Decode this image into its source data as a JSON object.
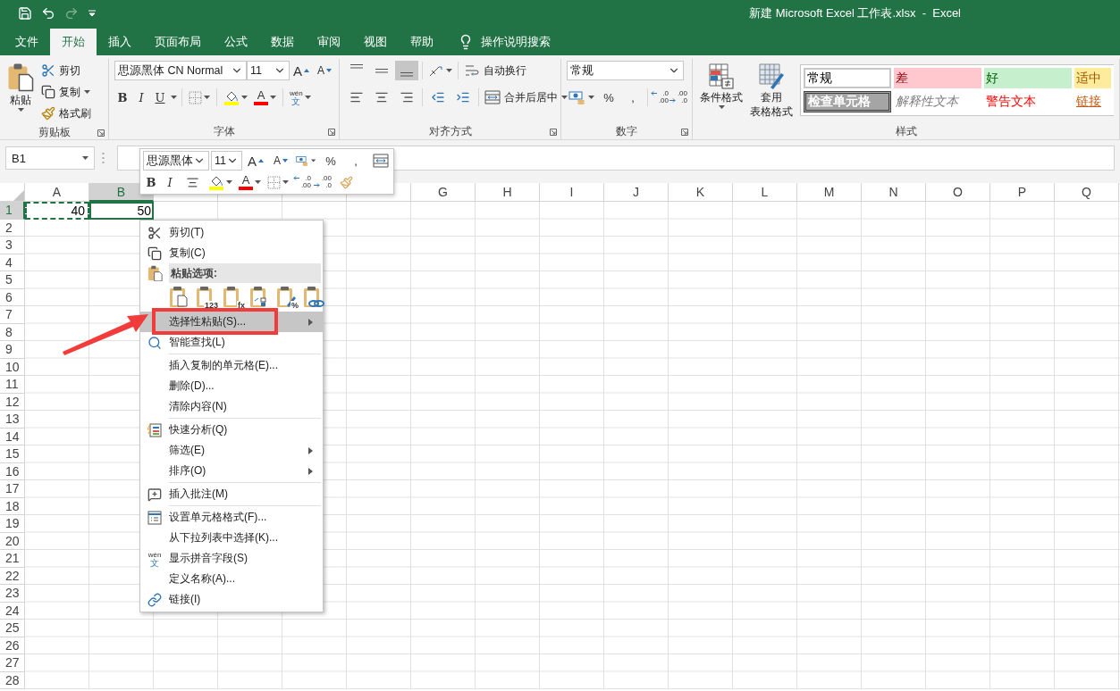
{
  "title_bar": {
    "title": "新建 Microsoft Excel 工作表.xlsx  -  Excel"
  },
  "tabs": [
    {
      "label": "文件",
      "selected": false
    },
    {
      "label": "开始",
      "selected": true
    },
    {
      "label": "插入",
      "selected": false
    },
    {
      "label": "页面布局",
      "selected": false
    },
    {
      "label": "公式",
      "selected": false
    },
    {
      "label": "数据",
      "selected": false
    },
    {
      "label": "审阅",
      "selected": false
    },
    {
      "label": "视图",
      "selected": false
    },
    {
      "label": "帮助",
      "selected": false
    }
  ],
  "tell_me": {
    "label": "操作说明搜索"
  },
  "ribbon": {
    "clipboard": {
      "label": "剪贴板",
      "paste": "粘贴",
      "cut": "剪切",
      "copy": "复制",
      "format_painter": "格式刷"
    },
    "font": {
      "label": "字体",
      "font_name": "思源黑体 CN Normal",
      "font_size": "11",
      "grow": "A",
      "shrink": "A",
      "bold": "B",
      "italic": "I",
      "underline": "U",
      "font_color": "A",
      "phonetic": [
        "wén",
        "文"
      ]
    },
    "alignment": {
      "label": "对齐方式",
      "wrap_text": "自动换行",
      "merge_center": "合并后居中"
    },
    "number": {
      "label": "数字",
      "format": "常规",
      "percent": "%",
      "comma": ",",
      "decimal_buttons": [
        {
          "kind": "increase",
          "top": ".0",
          "bottom": ".00"
        },
        {
          "kind": "decrease",
          "top": ".00",
          "bottom": ".0"
        }
      ]
    },
    "styles": {
      "label": "样式",
      "conditional_format": "条件格式",
      "table_format": [
        "套用",
        "表格格式"
      ],
      "cell_styles": [
        {
          "label": "常规",
          "kind": "normal"
        },
        {
          "label": "差",
          "kind": "bad"
        },
        {
          "label": "好",
          "kind": "good"
        },
        {
          "label": "适中",
          "kind": "neutral"
        },
        {
          "label": "检查单元格",
          "kind": "check"
        },
        {
          "label": "解释性文本",
          "kind": "explanatory"
        },
        {
          "label": "警告文本",
          "kind": "warning"
        },
        {
          "label": "链接",
          "kind": "link"
        }
      ]
    }
  },
  "formula_bar": {
    "name_box": "B1"
  },
  "mini_toolbar": {
    "font_name": "思源黑体",
    "font_size": "11",
    "grow": "A",
    "shrink": "A",
    "percent": "%",
    "comma": ",",
    "bold": "B",
    "italic": "I",
    "font_color": "A",
    "decimal_buttons": [
      {
        "kind": "increase",
        "top": ".0",
        "bottom": ".00"
      },
      {
        "kind": "decrease",
        "top": ".00",
        "bottom": ".0"
      }
    ]
  },
  "sheet": {
    "columns": [
      {
        "label": "A",
        "selected": false
      },
      {
        "label": "B",
        "selected": true
      },
      {
        "selected": false
      },
      {
        "selected": false
      },
      {
        "selected": false
      },
      {
        "selected": false
      },
      {
        "label": "G",
        "selected": false
      },
      {
        "label": "H",
        "selected": false
      },
      {
        "label": "I",
        "selected": false
      },
      {
        "label": "J",
        "selected": false
      },
      {
        "label": "K",
        "selected": false
      },
      {
        "label": "L",
        "selected": false
      },
      {
        "label": "M",
        "selected": false
      },
      {
        "label": "N",
        "selected": false
      },
      {
        "label": "O",
        "selected": false
      },
      {
        "label": "P",
        "selected": false
      },
      {
        "label": "Q",
        "selected": false
      }
    ],
    "rows": [
      {
        "label": "1",
        "selected": true,
        "cells": [
          {
            "value": "40",
            "copied": true,
            "selected": false
          },
          {
            "value": "50",
            "copied": false,
            "selected": true
          }
        ]
      },
      {
        "label": "2",
        "selected": false
      },
      {
        "label": "3",
        "selected": false
      },
      {
        "label": "4",
        "selected": false
      },
      {
        "label": "5",
        "selected": false
      },
      {
        "label": "6",
        "selected": false
      },
      {
        "label": "7",
        "selected": false
      },
      {
        "label": "8",
        "selected": false
      },
      {
        "label": "9",
        "selected": false
      },
      {
        "label": "10",
        "selected": false
      },
      {
        "label": "11",
        "selected": false
      },
      {
        "label": "12",
        "selected": false
      },
      {
        "label": "13",
        "selected": false
      },
      {
        "label": "14",
        "selected": false
      },
      {
        "label": "15",
        "selected": false
      },
      {
        "label": "16",
        "selected": false
      },
      {
        "label": "17",
        "selected": false
      },
      {
        "label": "18",
        "selected": false
      },
      {
        "label": "19",
        "selected": false
      },
      {
        "label": "20",
        "selected": false
      },
      {
        "label": "21",
        "selected": false
      },
      {
        "label": "22",
        "selected": false
      },
      {
        "label": "23",
        "selected": false
      },
      {
        "label": "24",
        "selected": false
      },
      {
        "label": "25",
        "selected": false
      },
      {
        "label": "26",
        "selected": false
      },
      {
        "label": "27",
        "selected": false
      },
      {
        "label": "28",
        "selected": false
      }
    ]
  },
  "context_menu": {
    "items": [
      {
        "kind": "cut",
        "label": "剪切(T)",
        "selected": false,
        "submenu": false
      },
      {
        "kind": "copy",
        "label": "复制(C)",
        "selected": false,
        "submenu": false
      },
      {
        "kind": "header",
        "label": "粘贴选项:"
      },
      {
        "kind": "paste_options",
        "options": [
          {
            "kind": "paste"
          },
          {
            "kind": "values",
            "glyph": "123"
          },
          {
            "kind": "formulas",
            "glyph": "fx"
          },
          {
            "kind": "transpose"
          },
          {
            "kind": "formatting",
            "glyph": "%"
          },
          {
            "kind": "link"
          }
        ]
      },
      {
        "kind": "plain",
        "label": "选择性粘贴(S)...",
        "selected": true,
        "submenu": true
      },
      {
        "kind": "lookup",
        "label": "智能查找(L)",
        "selected": false,
        "submenu": false
      },
      {
        "kind": "separator"
      },
      {
        "kind": "plain",
        "label": "插入复制的单元格(E)...",
        "selected": false,
        "submenu": false
      },
      {
        "kind": "plain",
        "label": "删除(D)...",
        "selected": false,
        "submenu": false
      },
      {
        "kind": "plain",
        "label": "清除内容(N)",
        "selected": false,
        "submenu": false
      },
      {
        "kind": "separator"
      },
      {
        "kind": "quick_analysis",
        "label": "快速分析(Q)",
        "selected": false,
        "submenu": false
      },
      {
        "kind": "plain",
        "label": "筛选(E)",
        "selected": false,
        "submenu": true
      },
      {
        "kind": "plain",
        "label": "排序(O)",
        "selected": false,
        "submenu": true
      },
      {
        "kind": "separator"
      },
      {
        "kind": "comment",
        "label": "插入批注(M)",
        "selected": false,
        "submenu": false
      },
      {
        "kind": "separator"
      },
      {
        "kind": "format_cells",
        "label": "设置单元格格式(F)...",
        "selected": false,
        "submenu": false
      },
      {
        "kind": "plain",
        "label": "从下拉列表中选择(K)...",
        "selected": false,
        "submenu": false
      },
      {
        "kind": "phonetic",
        "label": "显示拼音字段(S)",
        "icon_text": [
          "wén",
          "文"
        ],
        "selected": false,
        "submenu": false
      },
      {
        "kind": "plain",
        "label": "定义名称(A)...",
        "selected": false,
        "submenu": false
      },
      {
        "kind": "link",
        "label": "链接(I)",
        "selected": false,
        "submenu": false
      }
    ]
  }
}
